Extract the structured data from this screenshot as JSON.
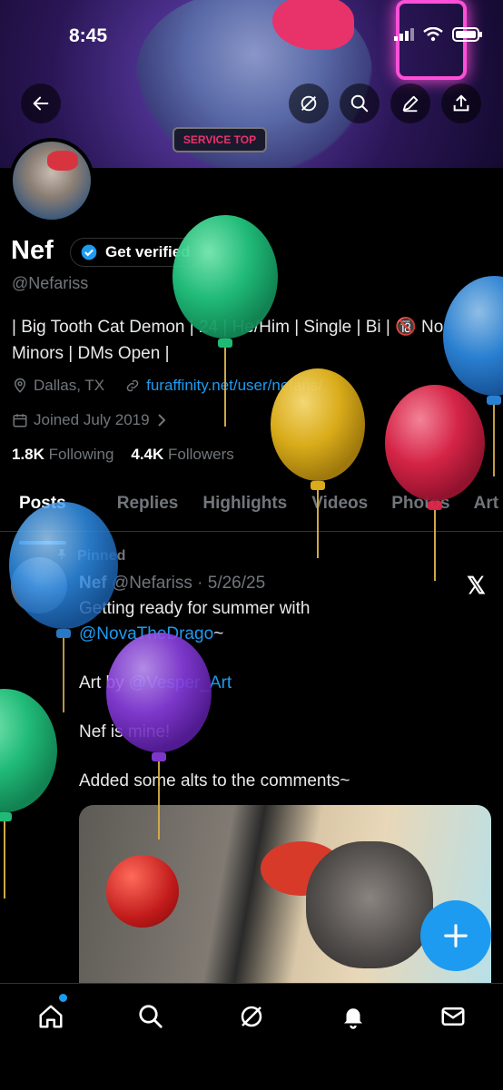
{
  "status_bar": {
    "time": "8:45"
  },
  "header": {
    "banner_text": "SERVICE TOP"
  },
  "profile": {
    "name": "Nef",
    "verify_label": "Get verified",
    "handle": "@Nefariss",
    "bio_line1": "| Big Tooth Cat Demon | 24 | He/Him | Single | Bi | 🔞 No",
    "bio_line2": "Minors | DMs Open |",
    "location": "Dallas, TX",
    "website": "furaffinity.net/user/nefaris/",
    "joined": "Joined July 2019",
    "following_count": "1.8K",
    "following_label": "Following",
    "followers_count": "4.4K",
    "followers_label": "Followers"
  },
  "tabs": [
    {
      "label": "Posts",
      "active": true
    },
    {
      "label": "Replies"
    },
    {
      "label": "Highlights"
    },
    {
      "label": "Videos"
    },
    {
      "label": "Photos"
    },
    {
      "label": "Art"
    }
  ],
  "post": {
    "pinned_label": "Pinned",
    "author": "Nef",
    "handle_date": "@Nefariss · 5/26/25",
    "line1": "Getting ready for summer with",
    "mention1": "@NovaTheDrago",
    "mention1_suffix": "~",
    "art_by": "Art by ",
    "mention2": "@Vesper_Art",
    "line3": "Nef is mine!",
    "line4": "Added some alts to the comments~"
  },
  "colors": {
    "accent": "#1d9bf0",
    "background": "#000000",
    "muted": "#71767b"
  },
  "icons": [
    "back-arrow-icon",
    "grok-icon",
    "search-icon",
    "edit-icon",
    "share-icon",
    "verified-badge-icon",
    "location-icon",
    "link-icon",
    "calendar-icon",
    "pin-icon",
    "x-logo-icon",
    "plus-icon",
    "home-icon",
    "notifications-icon",
    "messages-icon"
  ]
}
